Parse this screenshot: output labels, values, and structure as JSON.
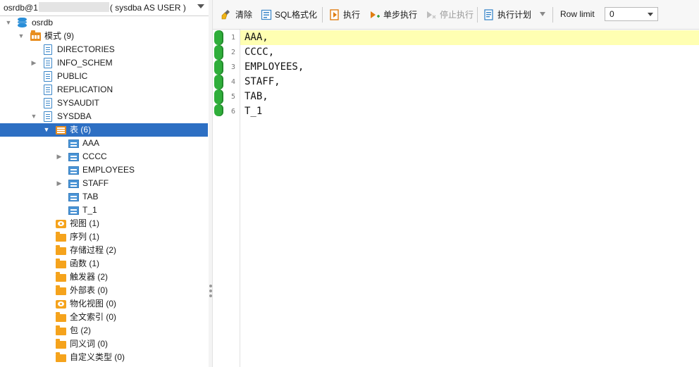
{
  "connection": {
    "prefix": "osrdb@1",
    "suffix": "( sysdba AS USER )"
  },
  "tree": {
    "root": "osrdb",
    "schemas_label": "模式 (9)",
    "schemas": [
      "DIRECTORIES",
      "INFO_SCHEM",
      "PUBLIC",
      "REPLICATION",
      "SYSAUDIT",
      "SYSDBA"
    ],
    "tables_group": "表 (6)",
    "tables": [
      "AAA",
      "CCCC",
      "EMPLOYEES",
      "STAFF",
      "TAB",
      "T_1"
    ],
    "objects": [
      "视图 (1)",
      "序列 (1)",
      "存储过程 (2)",
      "函数 (1)",
      "触发器 (2)",
      "外部表 (0)",
      "物化视图 (0)",
      "全文索引 (0)",
      "包 (2)",
      "同义词 (0)",
      "自定义类型 (0)"
    ]
  },
  "toolbar": {
    "clear": "清除",
    "sql_format": "SQL格式化",
    "execute": "执行",
    "step_execute": "单步执行",
    "stop_execute": "停止执行",
    "exec_plan": "执行计划",
    "row_limit_label": "Row limit",
    "row_limit_value": "0"
  },
  "editor": {
    "lines": [
      {
        "no": "1",
        "text": "AAA,"
      },
      {
        "no": "2",
        "text": "CCCC,"
      },
      {
        "no": "3",
        "text": "EMPLOYEES,"
      },
      {
        "no": "4",
        "text": "STAFF,"
      },
      {
        "no": "5",
        "text": "TAB,"
      },
      {
        "no": "6",
        "text": "T_1"
      }
    ],
    "current_line_color": "#ffffb2",
    "marker_color": "#2fae3a"
  },
  "colors": {
    "selection": "#2d6fc3",
    "folder": "#f5a31c",
    "table": "#4a94d6"
  }
}
